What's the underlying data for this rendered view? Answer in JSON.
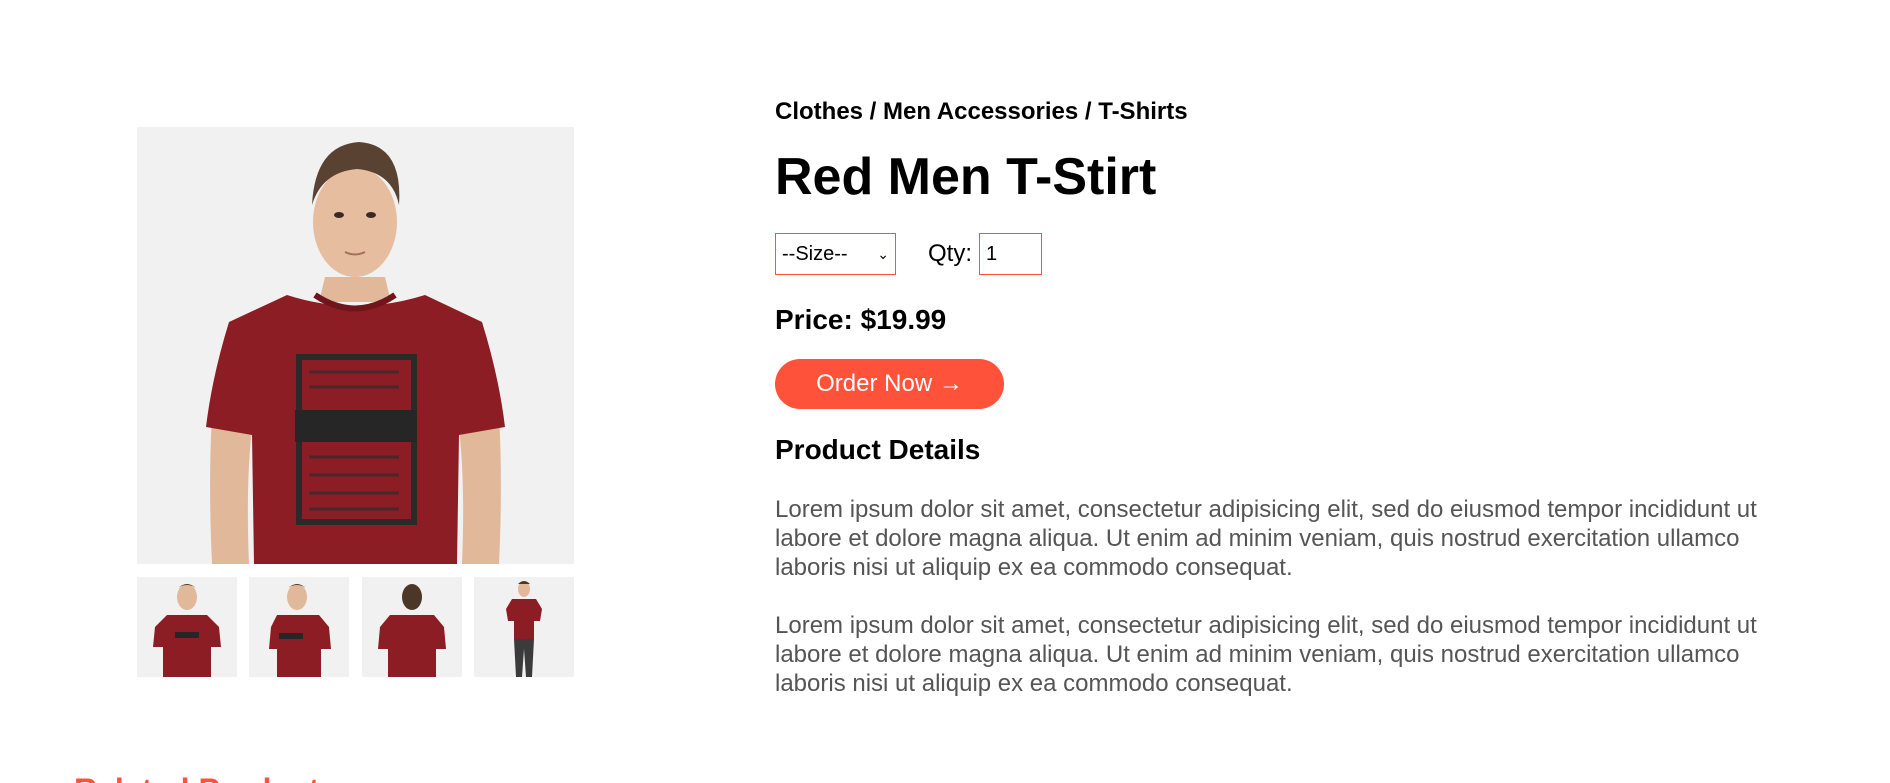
{
  "breadcrumb": "Clothes / Men Accessories / T-Shirts",
  "product": {
    "title": "Red Men T-Stirt",
    "price": "Price: $19.99"
  },
  "size_select": {
    "selected": "--Size--"
  },
  "quantity": {
    "label": "Qty:",
    "value": "1"
  },
  "order_button": {
    "label": "Order Now →"
  },
  "details": {
    "heading": "Product Details",
    "paragraphs": [
      "Lorem ipsum dolor sit amet, consectetur adipisicing elit, sed do eiusmod tempor incididunt ut labore et dolore magna aliqua. Ut enim ad minim veniam, quis nostrud exercitation ullamco laboris nisi ut aliquip ex ea commodo consequat.",
      "Lorem ipsum dolor sit amet, consectetur adipisicing elit, sed do eiusmod tempor incididunt ut labore et dolore magna aliqua. Ut enim ad minim veniam, quis nostrud exercitation ullamco laboris nisi ut aliquip ex ea commodo consequat."
    ]
  },
  "related": {
    "heading": "Related Products"
  },
  "colors": {
    "accent": "#ff523b",
    "shirt": "#8c1d24",
    "image_bg": "#f1f1f1",
    "paragraph_text": "#555555"
  },
  "gallery": {
    "thumbnails": [
      "front-view",
      "side-view",
      "back-view",
      "full-body-view"
    ]
  }
}
